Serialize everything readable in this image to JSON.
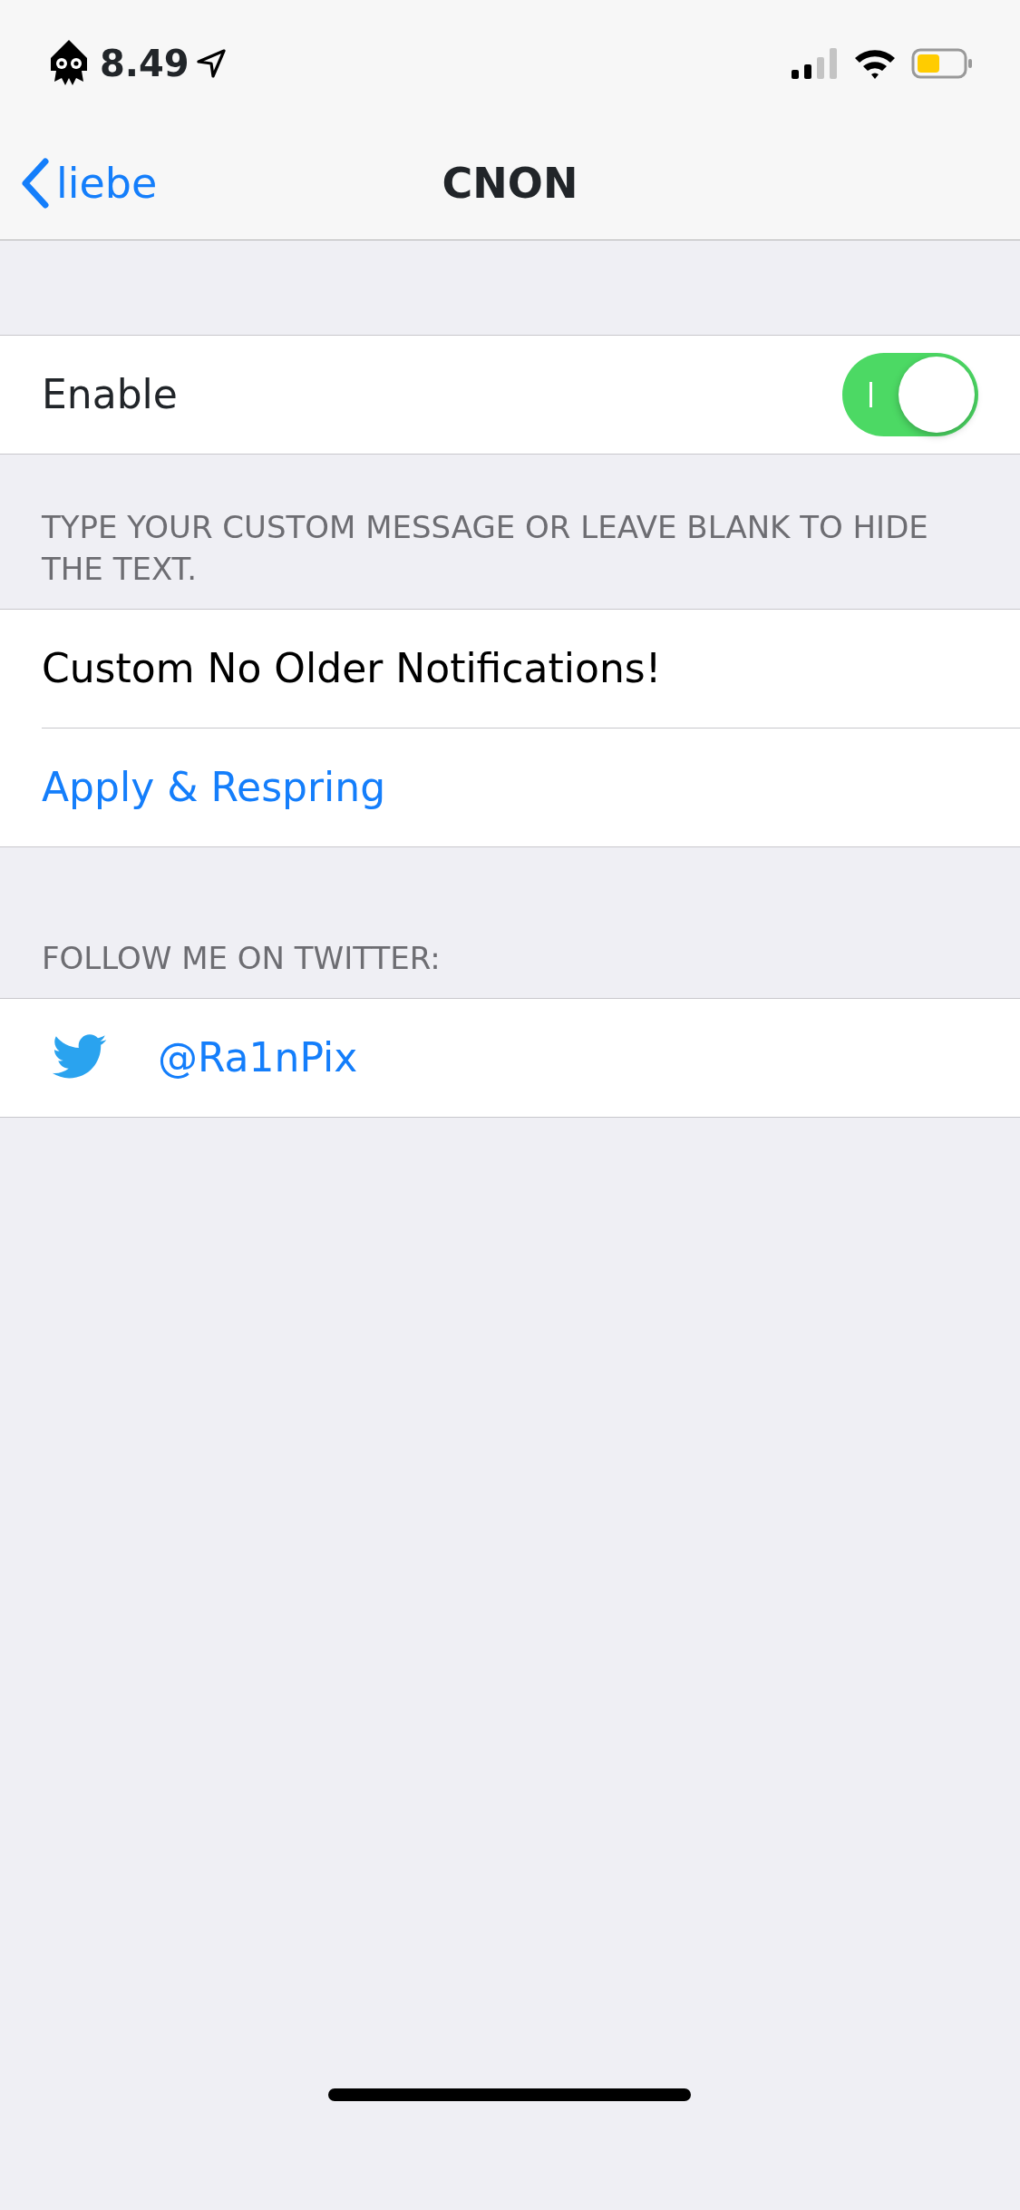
{
  "status_bar": {
    "time": "8.49"
  },
  "nav": {
    "back": "liebe",
    "title": "CNON"
  },
  "enable": {
    "label": "Enable",
    "on": true
  },
  "message_section": {
    "header": "TYPE YOUR CUSTOM MESSAGE OR LEAVE BLANK TO HIDE THE TEXT.",
    "value": "Custom No Older Notifications!",
    "action": "Apply & Respring"
  },
  "twitter_section": {
    "header": "FOLLOW ME ON TWITTER:",
    "handle": "@Ra1nPix"
  }
}
